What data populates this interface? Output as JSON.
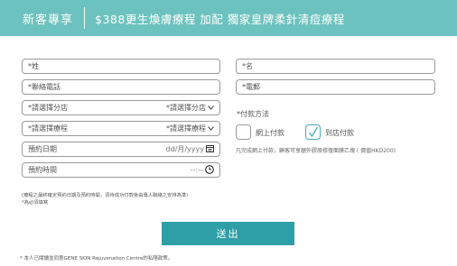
{
  "banner": {
    "tag": "新客專享",
    "promo": "$388更生煥膚療程 加配 獨家皇牌柔針清痘療程",
    "color": "#6cc2be"
  },
  "form": {
    "surname_placeholder": "*姓",
    "given_name_placeholder": "*名",
    "phone_placeholder": "*聯絡電話",
    "email_placeholder": "*電郵",
    "branch_placeholder": "*請選擇分店",
    "branch_select": "*請選擇分店",
    "treatment_placeholder": "*請選擇療程",
    "treatment_select": "*請選擇療程",
    "date_label": "預約日期",
    "date_format": "dd/月/yyyy",
    "time_label": "預約時間",
    "time_format": "--:--",
    "date_icon": "calendar-icon",
    "time_icon": "clock-icon"
  },
  "payment": {
    "label": "*付款方法",
    "options": [
      {
        "label": "網上付款",
        "checked": false
      },
      {
        "label": "到店付款",
        "checked": true
      }
    ],
    "note": "凡完成網上付款，顧客可享額外膠原修復面膜乙塊 ( 價值HKD200)",
    "accent": "#47aab5"
  },
  "notices": {
    "line1": "(療程之最終確定預約日期及預約時間，須待成功付款後由專人聯絡之安排為準)",
    "line2": "*為必須填寫"
  },
  "submit": {
    "label": "送出",
    "color": "#2e9fa6"
  },
  "footer": {
    "text": "* 本人已閱讀並同意GENE SKIN Rejuvenation Centre的私隱政策。"
  }
}
